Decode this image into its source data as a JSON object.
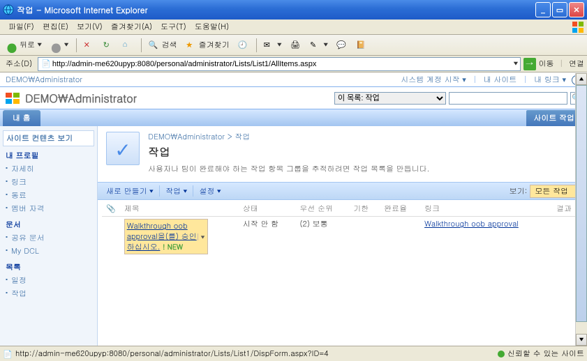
{
  "window": {
    "title": "작업 - Microsoft Internet Explorer"
  },
  "menu": {
    "file": "파일(F)",
    "edit": "편집(E)",
    "view": "보기(V)",
    "favorites": "즐겨찾기(A)",
    "tools": "도구(T)",
    "help": "도움말(H)"
  },
  "toolbar": {
    "back": "뒤로",
    "search": "검색",
    "favorites": "즐겨찾기"
  },
  "address": {
    "label": "주소(D)",
    "url": "http://admin-me620upyp:8080/personal/administrator/Lists/List1/AllItems.aspx",
    "go": "이동",
    "links": "연결"
  },
  "sp": {
    "topbar": {
      "breadcrumb": "DEMO\\Administrator",
      "welcome": "시스템 계정 시작",
      "mysite": "내 사이트",
      "mylinks": "내 링크"
    },
    "site_title": "DEMO\\Administrator",
    "search_scope": "이 목록: 작업",
    "tab_home": "내 홈",
    "site_actions": "사이트 작업",
    "quicklaunch": {
      "view_all": "사이트 컨텐츠 보기",
      "profile": "내 프로필",
      "profile_items": [
        "자세히",
        "링크",
        "동료",
        "멤버 자격"
      ],
      "docs": "문서",
      "docs_items": [
        "공유 문서",
        "My DCL"
      ],
      "lists": "목록",
      "lists_items": [
        "일정",
        "작업"
      ]
    },
    "page": {
      "bc_root": "DEMO\\Administrator",
      "bc_sep": ">",
      "bc_cur": "작업",
      "title": "작업",
      "desc": "사용자나 팀이 완료해야 하는 작업 항목 그룹을 추적하려면 작업 목록을 만듭니다."
    },
    "list_toolbar": {
      "new": "새로 만들기",
      "actions": "작업",
      "settings": "설정",
      "view_label": "보기:",
      "view_current": "모든 작업"
    },
    "columns": {
      "attach": "📎",
      "title": "제목",
      "status": "상태",
      "priority": "우선 순위",
      "due": "기한",
      "pct": "완료율",
      "link": "링크",
      "result": "결과"
    },
    "rows": [
      {
        "title": "Walkthrough oob approval을(를) 승인하십시오.",
        "new_tag": "! NEW",
        "status": "시작 안 함",
        "priority": "(2) 보통",
        "due": "",
        "pct": "",
        "link": "Walkthrough oob approval",
        "result": ""
      }
    ]
  },
  "status": {
    "url": "http://admin-me620upyp:8080/personal/administrator/Lists/List1/DispForm.aspx?ID=4",
    "zone": "신뢰할 수 있는 사이트"
  }
}
